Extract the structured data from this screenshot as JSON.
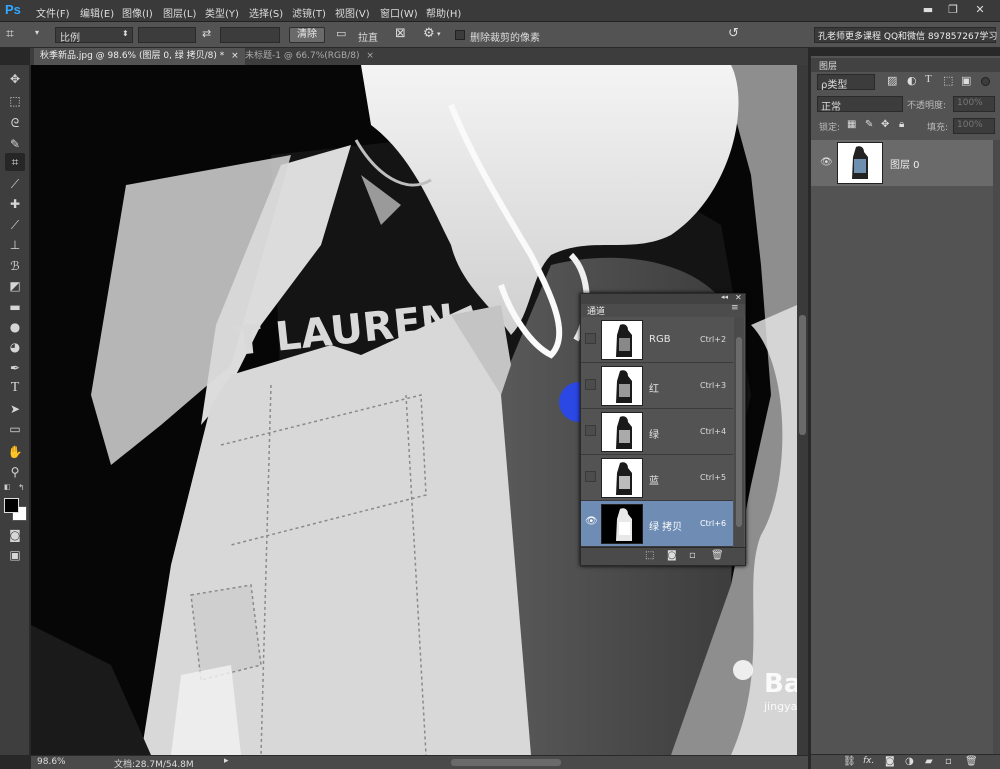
{
  "app": {
    "logo": "Ps"
  },
  "menu": [
    "文件(F)",
    "编辑(E)",
    "图像(I)",
    "图层(L)",
    "类型(Y)",
    "选择(S)",
    "滤镜(T)",
    "视图(V)",
    "窗口(W)",
    "帮助(H)"
  ],
  "window_controls": {
    "minimize": "▬",
    "restore": "❐",
    "close": "✕"
  },
  "options": {
    "ratio_select": "比例",
    "clear_button": "清除",
    "straighten_label": "拉直",
    "delete_cropped_label": "删除裁剪的像素",
    "workspace_note": "孔老师更多课程 QQ和微信 897857267学习"
  },
  "tabs": [
    {
      "label": "秋季新品.jpg @ 98.6% (图层 0, 绿 拷贝/8) *",
      "close": "×"
    },
    {
      "label": "未标题-1 @ 66.7%(RGB/8)",
      "close": "×"
    }
  ],
  "status": {
    "zoom": "98.6%",
    "doc": "文档:28.7M/54.8M"
  },
  "layers_panel": {
    "title": "图层",
    "filter_select": "ρ类型",
    "blend_mode": "正常",
    "opacity_label": "不透明度:",
    "opacity_value": "100%",
    "lock_label": "锁定:",
    "fill_label": "填充:",
    "fill_value": "100%",
    "layer_name": "图层 0"
  },
  "channels_panel": {
    "title": "通道",
    "collapse": "◂◂",
    "close": "✕",
    "menu": "≡",
    "rows": [
      {
        "name": "RGB",
        "shortcut": "Ctrl+2",
        "visible": false,
        "selected": false
      },
      {
        "name": "红",
        "shortcut": "Ctrl+3",
        "visible": false,
        "selected": false
      },
      {
        "name": "绿",
        "shortcut": "Ctrl+4",
        "visible": false,
        "selected": false
      },
      {
        "name": "蓝",
        "shortcut": "Ctrl+5",
        "visible": false,
        "selected": false
      },
      {
        "name": "绿 拷贝",
        "shortcut": "Ctrl+6",
        "visible": true,
        "selected": true
      }
    ]
  },
  "canvas_text": "T LAUREN",
  "watermark": {
    "brand": "Bai 经验",
    "url": "jingyan.baidu.com"
  },
  "colors": {
    "selected_row": "#6e8cb4",
    "accent_cursor": "#1a3cff",
    "ps_blue": "#31a8ff"
  }
}
